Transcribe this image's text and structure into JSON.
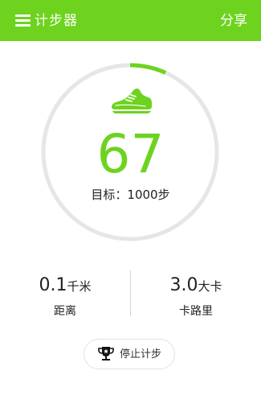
{
  "app_bar": {
    "menu_icon": "hamburger-menu-icon",
    "title": "计步器",
    "share_label": "分享",
    "background_color": "#6dd31e"
  },
  "progress_ring": {
    "progress_fraction": 0.067,
    "track_color": "#e6e6e6",
    "progress_color": "#6dd31e",
    "icon": "running-shoe-icon",
    "step_count": "67",
    "goal_text": "目标：1000步"
  },
  "stats": {
    "distance": {
      "value": "0.1",
      "unit": "千米",
      "label": "距离"
    },
    "calories": {
      "value": "3.0",
      "unit": "大卡",
      "label": "卡路里"
    }
  },
  "stop_button": {
    "icon": "trophy-icon",
    "label": "停止计步"
  }
}
